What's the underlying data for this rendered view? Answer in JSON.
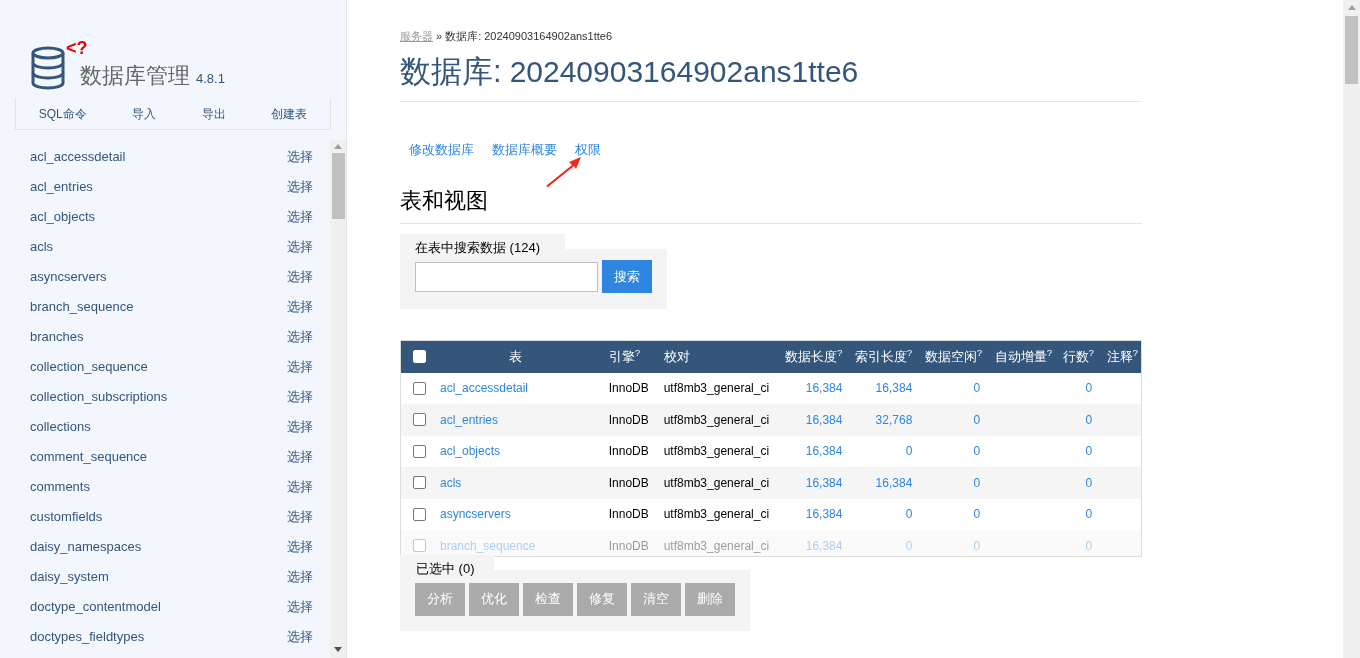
{
  "sidebar": {
    "logo_mark": "<?",
    "title": "数据库管理",
    "version": "4.8.1",
    "menu": [
      "SQL命令",
      "导入",
      "导出",
      "创建表"
    ],
    "tables": [
      {
        "name": "acl_accessdetail",
        "action": "选择"
      },
      {
        "name": "acl_entries",
        "action": "选择"
      },
      {
        "name": "acl_objects",
        "action": "选择"
      },
      {
        "name": "acls",
        "action": "选择"
      },
      {
        "name": "asyncservers",
        "action": "选择"
      },
      {
        "name": "branch_sequence",
        "action": "选择"
      },
      {
        "name": "branches",
        "action": "选择"
      },
      {
        "name": "collection_sequence",
        "action": "选择"
      },
      {
        "name": "collection_subscriptions",
        "action": "选择"
      },
      {
        "name": "collections",
        "action": "选择"
      },
      {
        "name": "comment_sequence",
        "action": "选择"
      },
      {
        "name": "comments",
        "action": "选择"
      },
      {
        "name": "customfields",
        "action": "选择"
      },
      {
        "name": "daisy_namespaces",
        "action": "选择"
      },
      {
        "name": "daisy_system",
        "action": "选择"
      },
      {
        "name": "doctype_contentmodel",
        "action": "选择"
      },
      {
        "name": "doctypes_fieldtypes",
        "action": "选择"
      }
    ]
  },
  "breadcrumb": {
    "link": "服务器",
    "separator": "»",
    "current": "数据库: 20240903164902ans1tte6"
  },
  "heading": {
    "label": "数据库:",
    "name": "20240903164902ans1tte6"
  },
  "links": [
    "修改数据库",
    "数据库概要",
    "权限"
  ],
  "section_title": "表和视图",
  "search": {
    "legend": "在表中搜索数据 (124)",
    "button": "搜索"
  },
  "table": {
    "select_all_checked": false,
    "columns": [
      "表",
      "引擎$^{?}$",
      "校对",
      "数据长度$^{?}$",
      "索引长度$^{?}$",
      "数据空闲$^{?}$",
      "自动增量$^{?}$",
      "行数$^{?}$",
      "注释$^{?}$"
    ],
    "rows": [
      {
        "checked": false,
        "name": "acl_accessdetail",
        "engine": "InnoDB",
        "collation": "utf8mb3_general_ci",
        "data_length": "16,384",
        "index_length": "16,384",
        "data_free": "0",
        "rows": "0"
      },
      {
        "checked": false,
        "name": "acl_entries",
        "engine": "InnoDB",
        "collation": "utf8mb3_general_ci",
        "data_length": "16,384",
        "index_length": "32,768",
        "data_free": "0",
        "rows": "0"
      },
      {
        "checked": false,
        "name": "acl_objects",
        "engine": "InnoDB",
        "collation": "utf8mb3_general_ci",
        "data_length": "16,384",
        "index_length": "0",
        "data_free": "0",
        "rows": "0"
      },
      {
        "checked": false,
        "name": "acls",
        "engine": "InnoDB",
        "collation": "utf8mb3_general_ci",
        "data_length": "16,384",
        "index_length": "16,384",
        "data_free": "0",
        "rows": "0"
      },
      {
        "checked": false,
        "name": "asyncservers",
        "engine": "InnoDB",
        "collation": "utf8mb3_general_ci",
        "data_length": "16,384",
        "index_length": "0",
        "data_free": "0",
        "rows": "0"
      },
      {
        "checked": false,
        "name": "branch_sequence",
        "engine": "InnoDB",
        "collation": "utf8mb3_general_ci",
        "data_length": "16,384",
        "index_length": "0",
        "data_free": "0",
        "rows": "0"
      }
    ]
  },
  "selection": {
    "legend": "已选中 (0)",
    "buttons": [
      {
        "label": "分析",
        "disabled": true
      },
      {
        "label": "优化",
        "disabled": true
      },
      {
        "label": "检查",
        "disabled": true
      },
      {
        "label": "修复",
        "disabled": true
      },
      {
        "label": "清空",
        "disabled": true
      },
      {
        "label": "删除",
        "disabled": true
      }
    ]
  }
}
